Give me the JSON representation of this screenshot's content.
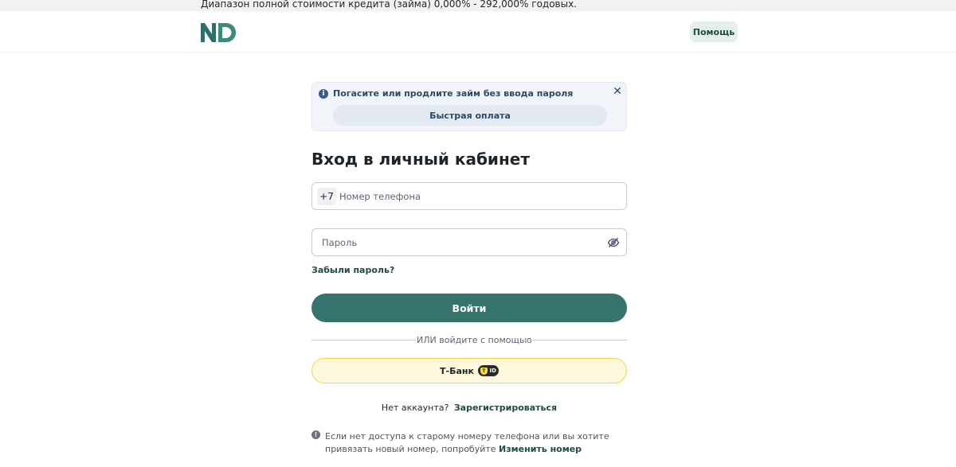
{
  "topbar": {
    "text": "Диапазон полной стоимости кредита (займа) 0,000% - 292,000% годовых."
  },
  "header": {
    "logo": "ND",
    "help_label": "Помощь"
  },
  "notice": {
    "text": "Погасите или продлите займ без ввода пароля",
    "button_label": "Быстрая оплата",
    "close_glyph": "✕",
    "info_glyph": "i"
  },
  "login": {
    "title": "Вход в личный кабинет",
    "phone_prefix": "+7",
    "phone_placeholder": "Номер телефона",
    "password_placeholder": "Пароль",
    "forgot_label": "Забыли пароль?",
    "submit_label": "Войти",
    "divider_text": "ИЛИ войдите с помощью",
    "tbank_label": "Т-Банк",
    "tbank_badge": "ID"
  },
  "register": {
    "prompt": "Нет аккаунта?",
    "link": "Зарегистрироваться"
  },
  "info": {
    "glyph": "!",
    "text": "Если нет доступа к старому номеру телефона или вы хотите привязать новый номер, попробуйте",
    "link": "Изменить номер"
  },
  "colors": {
    "brand": "#36736d",
    "brand_dark": "#1f4a45",
    "notice_bg": "#f1f5fa",
    "tbank_bg": "#fdf8dc",
    "tbank_border": "#f2d34c"
  },
  "icons": {
    "eye": "eye-slash-icon",
    "close": "close-icon",
    "info": "info-icon"
  }
}
